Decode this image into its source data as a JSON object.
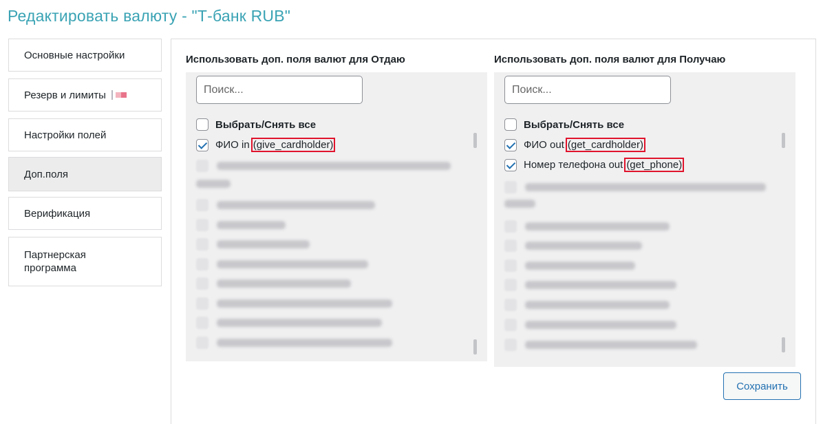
{
  "page": {
    "title": "Редактировать валюту - \"Т-банк RUB\""
  },
  "tabs": [
    {
      "label": "Основные настройки"
    },
    {
      "label": "Резерв и лимиты"
    },
    {
      "label": "Настройки полей"
    },
    {
      "label": "Доп.поля",
      "active": true
    },
    {
      "label": "Верификация"
    },
    {
      "label": "Партнерская программа"
    }
  ],
  "give": {
    "title": "Использовать доп. поля валют для Отдаю",
    "search_placeholder": "Поиск...",
    "select_all": "Выбрать/Снять все",
    "items": [
      {
        "label": "ФИО in",
        "code": "(give_cardholder)",
        "checked": true
      }
    ]
  },
  "get": {
    "title": "Использовать доп. поля валют для Получаю",
    "search_placeholder": "Поиск...",
    "select_all": "Выбрать/Снять все",
    "items": [
      {
        "label": "ФИО out",
        "code": "(get_cardholder)",
        "checked": true
      },
      {
        "label": "Номер телефона out",
        "code": "(get_phone)",
        "checked": true
      }
    ]
  },
  "actions": {
    "save_label": "Сохранить"
  },
  "colors": {
    "title": "#3aa3b4",
    "highlight": "#e0132b",
    "accent": "#2271b1"
  }
}
